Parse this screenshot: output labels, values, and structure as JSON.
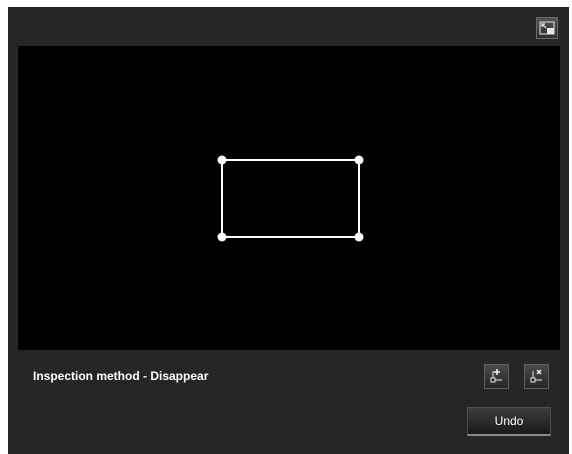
{
  "method_label": "Inspection method - Disappear",
  "buttons": {
    "undo_label": "Undo"
  },
  "icons": {
    "fullscreen": "fullscreen-toggle-icon",
    "add_point": "add-vertex-icon",
    "remove_point": "remove-vertex-icon"
  },
  "colors": {
    "panel_background": "#262626",
    "video_background": "#000000",
    "detection_area_outline": "#ffffff",
    "text": "#ffffff"
  }
}
